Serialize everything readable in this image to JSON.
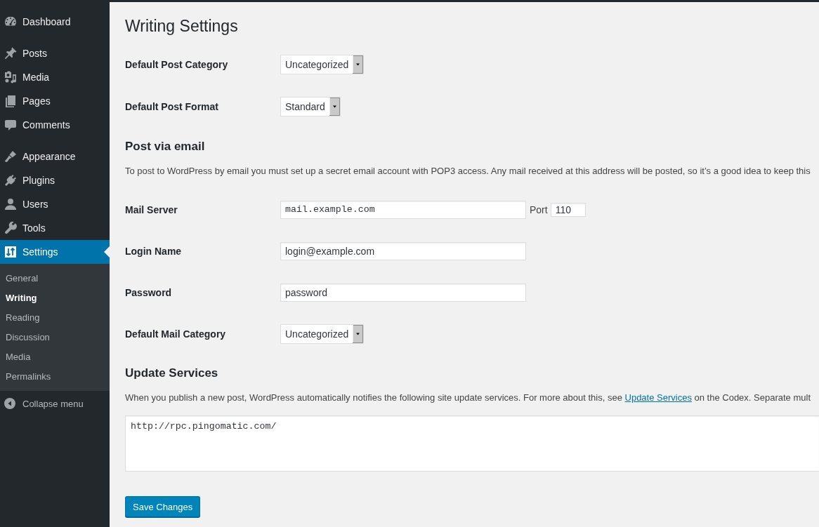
{
  "sidebar": {
    "groups": [
      {
        "items": [
          {
            "label": "Dashboard",
            "selected": false
          }
        ]
      },
      {
        "items": [
          {
            "label": "Posts",
            "selected": false
          },
          {
            "label": "Media",
            "selected": false
          },
          {
            "label": "Pages",
            "selected": false
          },
          {
            "label": "Comments",
            "selected": false
          }
        ]
      },
      {
        "items": [
          {
            "label": "Appearance",
            "selected": false
          },
          {
            "label": "Plugins",
            "selected": false
          },
          {
            "label": "Users",
            "selected": false
          },
          {
            "label": "Tools",
            "selected": false
          },
          {
            "label": "Settings",
            "selected": true,
            "children": [
              {
                "label": "General",
                "selected": false
              },
              {
                "label": "Writing",
                "selected": true
              },
              {
                "label": "Reading",
                "selected": false
              },
              {
                "label": "Discussion",
                "selected": false
              },
              {
                "label": "Media",
                "selected": false
              },
              {
                "label": "Permalinks",
                "selected": false
              }
            ]
          }
        ]
      }
    ],
    "collapse_label": "Collapse menu"
  },
  "title": "Writing Settings",
  "general_fields": [
    {
      "kind": "select",
      "label": "Default Post Category",
      "value": "Uncategorized"
    },
    {
      "kind": "select",
      "label": "Default Post Format",
      "value": "Standard"
    }
  ],
  "sections": [
    {
      "heading": "Post via email",
      "description": [
        {
          "kind": "text",
          "text": "To post to WordPress by email you must set up a secret email account with POP3 access. Any mail received at this address will be posted, so it’s a good idea to keep this"
        }
      ],
      "fields": [
        {
          "kind": "input",
          "label": "Mail Server",
          "value": "mail.example.com",
          "monospace": true,
          "port": {
            "label": "Port",
            "value": "110"
          }
        },
        {
          "kind": "input",
          "label": "Login Name",
          "value": "login@example.com",
          "monospace": false
        },
        {
          "kind": "input",
          "label": "Password",
          "value": "password",
          "monospace": false
        },
        {
          "kind": "select",
          "label": "Default Mail Category",
          "value": "Uncategorized"
        }
      ]
    },
    {
      "heading": "Update Services",
      "description": [
        {
          "kind": "text",
          "text": "When you publish a new post, WordPress automatically notifies the following site update services. For more about this, see "
        },
        {
          "kind": "link",
          "text": "Update Services"
        },
        {
          "kind": "text",
          "text": " on the Codex. Separate mult"
        }
      ],
      "fields": [
        {
          "kind": "textarea",
          "value": "http://rpc.pingomatic.com/"
        }
      ]
    }
  ],
  "submit": {
    "label": "Save Changes"
  }
}
